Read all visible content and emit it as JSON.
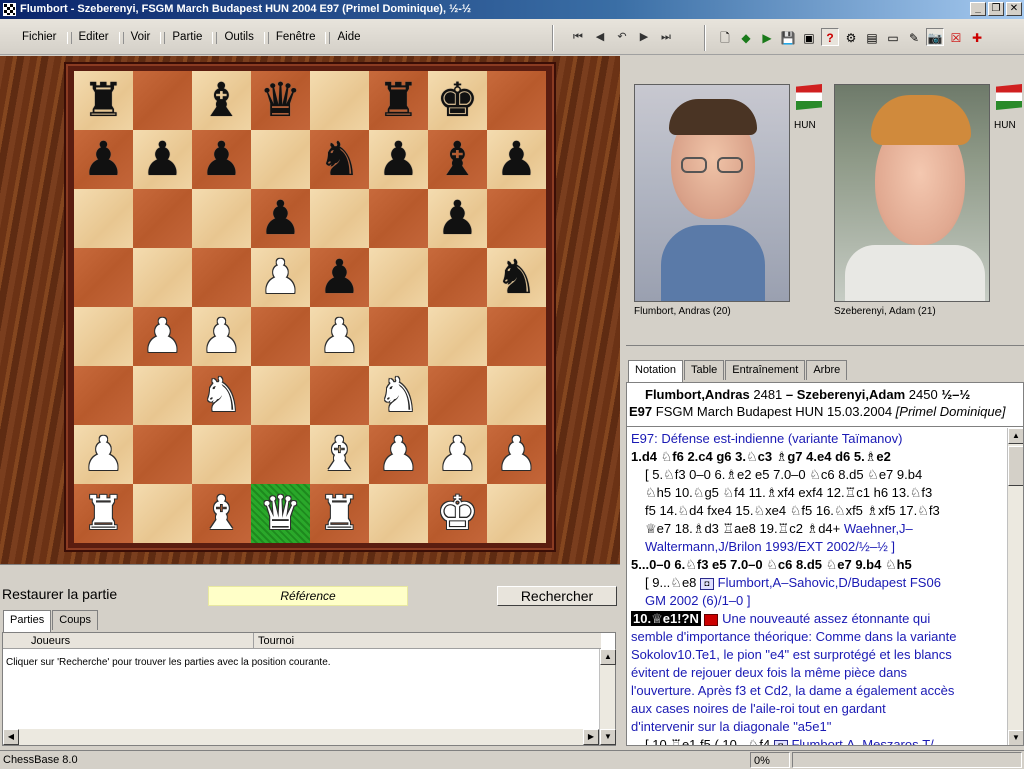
{
  "window": {
    "title": "Flumbort - Szeberenyi, FSGM March Budapest HUN 2004  E97  (Primel Dominique), ½-½",
    "controls": [
      "_",
      "❐",
      "✕"
    ]
  },
  "menu": {
    "items": [
      "Fichier",
      "Editer",
      "Voir",
      "Partie",
      "Outils",
      "Fenêtre",
      "Aide"
    ]
  },
  "toolbar": {
    "nav": [
      "⏮",
      "◀",
      "↶",
      "▶",
      "⏭"
    ],
    "tools": [
      "🗋",
      "◆",
      "▶",
      "💾",
      "▣",
      "?",
      "⚙",
      "▤",
      "▭",
      "✎",
      "📷",
      "☒",
      "✚"
    ]
  },
  "board": {
    "highlight_square": "d1",
    "rows": [
      [
        "bR",
        "",
        "bB",
        "bQ",
        "",
        "bR",
        "bK",
        ""
      ],
      [
        "bP",
        "bP",
        "bP",
        "",
        "bN",
        "bP",
        "bB",
        "bP"
      ],
      [
        "",
        "",
        "",
        "bP",
        "",
        "",
        "bP",
        ""
      ],
      [
        "",
        "",
        "",
        "wP",
        "bP",
        "",
        "",
        "bN"
      ],
      [
        "",
        "wP",
        "wP",
        "",
        "wP",
        "",
        "",
        ""
      ],
      [
        "",
        "",
        "wN",
        "",
        "",
        "wN",
        "",
        ""
      ],
      [
        "wP",
        "",
        "",
        "",
        "wB",
        "wP",
        "wP",
        "wP"
      ],
      [
        "wR",
        "",
        "wB",
        "wQ",
        "wR",
        "",
        "wK",
        ""
      ]
    ]
  },
  "reference": {
    "restore_label": "Restaurer la partie",
    "field_label": "Référence",
    "search_label": "Rechercher"
  },
  "games": {
    "tabs": [
      "Parties",
      "Coups"
    ],
    "columns": [
      "Joueurs",
      "Tournoi"
    ],
    "message": "Cliquer sur 'Recherche' pour trouver les parties avec la position courante."
  },
  "players": {
    "white": {
      "name": "Flumbort, Andras  (20)",
      "country": "HUN"
    },
    "black": {
      "name": "Szeberenyi, Adam  (21)",
      "country": "HUN"
    }
  },
  "notation": {
    "tabs": [
      "Notation",
      "Table",
      "Entraînement",
      "Arbre"
    ],
    "header_line1_white": "Flumbort,Andras",
    "header_line1_white_elo": "2481",
    "header_line1_dash": "–",
    "header_line1_black": "Szeberenyi,Adam",
    "header_line1_black_elo": "2450",
    "header_line1_result": "½–½",
    "header_line2_eco": "E97",
    "header_line2_event": "FSGM March Budapest HUN 15.03.2004",
    "header_line2_annotator": "[Primel Dominique]",
    "opening": "E97: Défense est-indienne (variante Taïmanov)",
    "main1": "1.d4  ♘f6  2.c4  g6  3.♘c3  ♗g7  4.e4  d6  5.♗e2",
    "var1_lines": [
      "[ 5.♘f3  0–0  6.♗e2  e5  7.0–0  ♘c6  8.d5  ♘e7  9.b4",
      "♘h5  10.♘g5  ♘f4  11.♗xf4  exf4  12.♖c1  h6  13.♘f3",
      "f5  14.♘d4  fxe4  15.♘xe4  ♘f5  16.♘xf5  ♗xf5  17.♘f3",
      "♕e7  18.♗d3  ♖ae8  19.♖c2  ♗d4+"
    ],
    "var1_ref": "Waehner,J–",
    "var1_ref2": "Waltermann,J/Brilon 1993/EXT 2002/½–½ ]",
    "main2": "5...0–0  6.♘f3  e5  7.0–0  ♘c6  8.d5  ♘e7  9.b4  ♘h5",
    "var2_move": "[ 9...♘e8",
    "var2_ref": "Flumbort,A–Sahovic,D/Budapest FS06",
    "var2_ref2": "GM 2002 (6)/1–0 ]",
    "novelty_move": "10.♕e1!?N",
    "comment_lines": [
      "Une nouveauté assez étonnante qui",
      "semble d'importance théorique: Comme dans la variante",
      "Sokolov10.Te1, le pion \"e4\" est surprotégé et les blancs",
      "évitent de rejouer deux fois la même pièce dans",
      "l'ouverture. Après f3 et Cd2, la dame a également accès",
      "aux cases noires de l'aile-roi tout en gardant",
      "d'intervenir sur la diagonale \"a5e1\""
    ],
    "var3_move": "[ 10.♖e1  f5  ( 10...♘f4",
    "var3_ref": "Flumbort,A–Meszaros,T/"
  },
  "status": {
    "app": "ChessBase 8.0",
    "progress": "0%"
  }
}
